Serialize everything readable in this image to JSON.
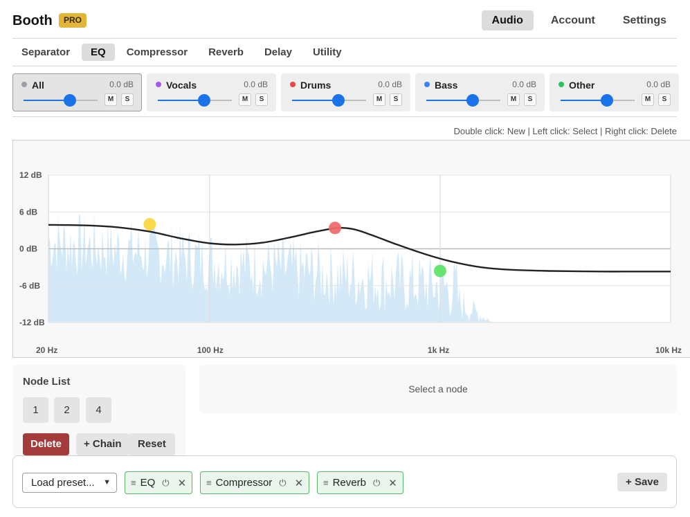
{
  "header": {
    "brand": "Booth",
    "badge": "PRO",
    "nav": [
      {
        "label": "Audio",
        "active": true
      },
      {
        "label": "Account",
        "active": false
      },
      {
        "label": "Settings",
        "active": false
      }
    ]
  },
  "module_tabs": [
    {
      "label": "Separator",
      "active": false
    },
    {
      "label": "EQ",
      "active": true
    },
    {
      "label": "Compressor",
      "active": false
    },
    {
      "label": "Reverb",
      "active": false
    },
    {
      "label": "Delay",
      "active": false
    },
    {
      "label": "Utility",
      "active": false
    }
  ],
  "stems": [
    {
      "name": "All",
      "gain": "0.0 dB",
      "color": "#9aa0a6",
      "level": 0.63,
      "mute": "M",
      "solo": "S",
      "selected": true
    },
    {
      "name": "Vocals",
      "gain": "0.0 dB",
      "color": "#a855f7",
      "level": 0.63,
      "mute": "M",
      "solo": "S",
      "selected": false
    },
    {
      "name": "Drums",
      "gain": "0.0 dB",
      "color": "#ef4444",
      "level": 0.63,
      "mute": "M",
      "solo": "S",
      "selected": false
    },
    {
      "name": "Bass",
      "gain": "0.0 dB",
      "color": "#3b82f6",
      "level": 0.63,
      "mute": "M",
      "solo": "S",
      "selected": false
    },
    {
      "name": "Other",
      "gain": "0.0 dB",
      "color": "#22c55e",
      "level": 0.63,
      "mute": "M",
      "solo": "S",
      "selected": false
    }
  ],
  "hint": "Double click: New | Left click: Select | Right click: Delete",
  "chart_data": {
    "type": "line",
    "xscale": "log",
    "xlim": [
      20,
      10000
    ],
    "ylim": [
      -12,
      12
    ],
    "xticks": [
      {
        "value": 20,
        "label": "20 Hz"
      },
      {
        "value": 100,
        "label": "100 Hz"
      },
      {
        "value": 1000,
        "label": "1k Hz"
      },
      {
        "value": 10000,
        "label": "10k Hz"
      }
    ],
    "yticks": [
      {
        "value": 12,
        "label": "12 dB"
      },
      {
        "value": 6,
        "label": "6 dB"
      },
      {
        "value": 0,
        "label": "0 dB"
      },
      {
        "value": -6,
        "label": "-6 dB"
      },
      {
        "value": -12,
        "label": "-12 dB"
      }
    ],
    "grid": true,
    "curve": {
      "x": [
        20,
        30,
        40,
        55,
        75,
        100,
        130,
        170,
        220,
        290,
        360,
        420,
        500,
        650,
        850,
        1100,
        1500,
        2000,
        3000,
        5000,
        7000,
        10000
      ],
      "y": [
        3.9,
        3.8,
        3.5,
        2.8,
        1.7,
        0.9,
        0.7,
        1.0,
        1.8,
        2.8,
        3.4,
        3.2,
        2.3,
        0.7,
        -0.8,
        -2.0,
        -3.0,
        -3.4,
        -3.6,
        -3.7,
        -3.7,
        -3.7
      ],
      "color": "#222222"
    },
    "nodes": [
      {
        "id": "1",
        "freq": 55,
        "gain": 4.0,
        "color": "#fbd743"
      },
      {
        "id": "2",
        "freq": 350,
        "gain": 3.4,
        "color": "#f06b6b"
      },
      {
        "id": "4",
        "freq": 1000,
        "gain": -3.6,
        "color": "#5fe36a"
      }
    ],
    "spectrum_color": "#d4e9f8"
  },
  "node_list": {
    "title": "Node List",
    "nodes": [
      "1",
      "2",
      "4"
    ],
    "delete_label": "Delete",
    "chain_label": "+ Chain",
    "reset_label": "Reset"
  },
  "node_detail": {
    "placeholder": "Select a node"
  },
  "chain": {
    "preset_placeholder": "Load preset...",
    "chips": [
      {
        "label": "EQ"
      },
      {
        "label": "Compressor"
      },
      {
        "label": "Reverb"
      }
    ],
    "save_label": "+ Save"
  },
  "icons": {
    "grip": "≡",
    "power": "⏻",
    "close": "✕",
    "chevron": "▼"
  }
}
